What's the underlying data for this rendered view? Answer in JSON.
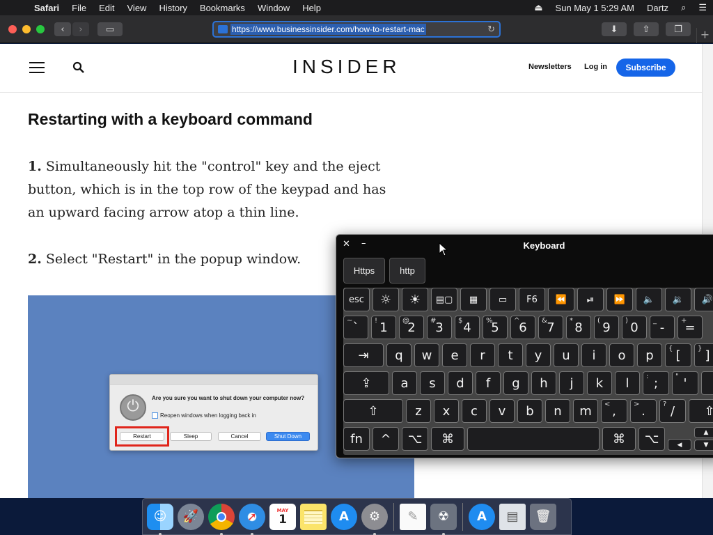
{
  "menubar": {
    "app": "Safari",
    "items": [
      "File",
      "Edit",
      "View",
      "History",
      "Bookmarks",
      "Window",
      "Help"
    ],
    "clock": "Sun May 1  5:29 AM",
    "user": "Dartz"
  },
  "toolbar": {
    "url": "https://www.businessinsider.com/how-to-restart-mac"
  },
  "site": {
    "logo": "INSIDER",
    "newsletters": "Newsletters",
    "login": "Log in",
    "subscribe": "Subscribe",
    "accent": "#1565e8"
  },
  "article": {
    "heading": "Restarting with a keyboard command",
    "step1_num": "1.",
    "step1_text": " Simultaneously hit the \"control\" key and the eject button, which is in the top row of the keypad and has an upward facing arrow atop a thin line.",
    "step2_num": "2.",
    "step2_text": " Select \"Restart\" in the popup window."
  },
  "dialog": {
    "question": "Are you sure you want to shut down your computer now?",
    "checkbox": "Reopen windows when logging back in",
    "buttons": [
      "Restart",
      "Sleep",
      "Cancel",
      "Shut Down"
    ]
  },
  "keyboard": {
    "title": "Keyboard",
    "suggestions": [
      "Https",
      "http"
    ],
    "esc": "esc",
    "f6": "F6",
    "row_numbers": [
      {
        "main": "`",
        "alt": "~"
      },
      {
        "main": "1",
        "alt": "!"
      },
      {
        "main": "2",
        "alt": "@"
      },
      {
        "main": "3",
        "alt": "#"
      },
      {
        "main": "4",
        "alt": "$"
      },
      {
        "main": "5",
        "alt": "%"
      },
      {
        "main": "6",
        "alt": "^"
      },
      {
        "main": "7",
        "alt": "&"
      },
      {
        "main": "8",
        "alt": "*"
      },
      {
        "main": "9",
        "alt": "("
      },
      {
        "main": "0",
        "alt": ")"
      },
      {
        "main": "-",
        "alt": "_"
      },
      {
        "main": "=",
        "alt": "+"
      }
    ],
    "row_q": [
      "q",
      "w",
      "e",
      "r",
      "t",
      "y",
      "u",
      "i",
      "o",
      "p"
    ],
    "row_a": [
      "a",
      "s",
      "d",
      "f",
      "g",
      "h",
      "j",
      "k",
      "l"
    ],
    "row_z": [
      "z",
      "x",
      "c",
      "v",
      "b",
      "n",
      "m"
    ],
    "bracket_l": {
      "main": "[",
      "alt": "{"
    },
    "bracket_r": {
      "main": "]",
      "alt": "}"
    },
    "semicolon": {
      "main": ";",
      "alt": ":"
    },
    "quote": {
      "main": "'",
      "alt": "\""
    },
    "comma": {
      "main": ",",
      "alt": "<"
    },
    "period": {
      "main": ".",
      "alt": ">"
    },
    "slash": {
      "main": "/",
      "alt": "?"
    },
    "fn_label": "fn"
  },
  "dock": {
    "calendar_month": "MAY",
    "calendar_day": "1"
  }
}
